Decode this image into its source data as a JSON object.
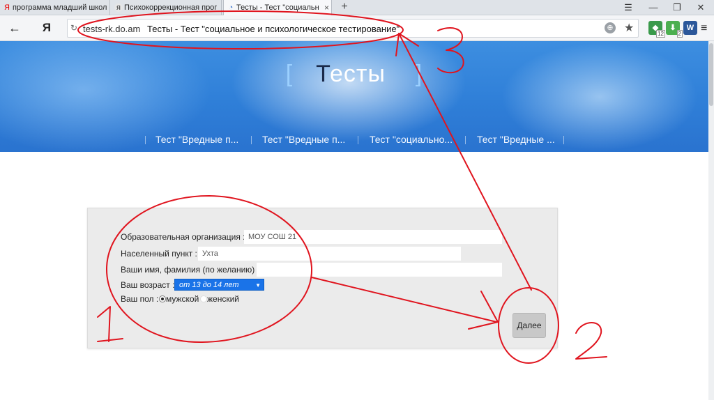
{
  "browser": {
    "tabs": [
      {
        "icon": "Я",
        "title": "программа младший школь"
      },
      {
        "icon": "я",
        "title": "Психокоррекционная прог"
      },
      {
        "icon": "◔",
        "title": "Тесты - Тест \"социально"
      }
    ],
    "close_glyph": "×",
    "new_tab_glyph": "+",
    "window_controls": {
      "list": "☰",
      "minimize": "—",
      "restore": "❐",
      "close": "✕"
    },
    "back_glyph": "←",
    "yandex_glyph": "Я",
    "reload_glyph": "↻",
    "url_domain": "tests-rk.do.am",
    "url_title": "Тесты - Тест \"социальное и психологическое тестирование\"",
    "globe_glyph": "⊕",
    "star_glyph": "★",
    "extensions": [
      {
        "icon": "shield-icon",
        "badge": "12",
        "color": "#3a9a4b"
      },
      {
        "icon": "download-icon",
        "badge": "2",
        "color": "#4caf50"
      },
      {
        "icon": "word-icon",
        "label": "W",
        "color": "#2b579a"
      }
    ],
    "menu_glyph": "≡"
  },
  "hero": {
    "bracket_left": "[",
    "title_first": "Т",
    "title_rest": "есты",
    "bracket_right": "]",
    "nav": [
      "Тест \"Вредные п...",
      "Тест \"Вредные п...",
      "Тест \"социально...",
      "Тест \"Вредные ..."
    ]
  },
  "form": {
    "org_label": "Образовательная организация :",
    "org_value": "МОУ СОШ 21",
    "city_label": "Населенный пункт :",
    "city_value": "Ухта",
    "name_label": "Ваши имя, фамилия (по желанию) :",
    "name_value": "",
    "age_label": "Ваш возраст :",
    "age_value": "от 13 до 14 лет",
    "age_arrow": "▼",
    "gender_label": "Ваш пол :",
    "gender_options": [
      {
        "label": "мужской",
        "checked": true
      },
      {
        "label": "женский",
        "checked": false
      }
    ],
    "next_button": "Далее"
  },
  "annotations": {
    "color": "#e0141e",
    "numbers": [
      "1",
      "2",
      "3"
    ]
  }
}
